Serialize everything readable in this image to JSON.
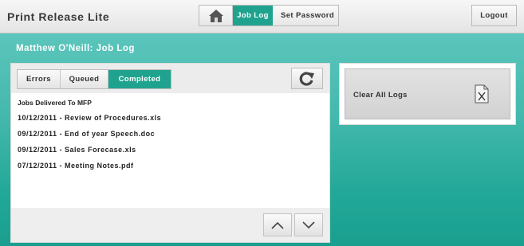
{
  "header": {
    "app_title": "Print Release Lite",
    "nav": {
      "home_icon": "home-icon",
      "job_log_label": "Job Log",
      "set_password_label": "Set Password"
    },
    "logout_label": "Logout"
  },
  "page": {
    "title": "Matthew O'Neill: Job Log"
  },
  "tabs": [
    {
      "label": "Errors",
      "selected": false
    },
    {
      "label": "Queued",
      "selected": false
    },
    {
      "label": "Completed",
      "selected": true
    }
  ],
  "toolbar": {
    "refresh_icon": "refresh-icon"
  },
  "job_list": {
    "heading": "Jobs Delivered To MFP",
    "items": [
      "10/12/2011 - Review of Procedures.xls",
      "09/12/2011 - End of year Speech.doc",
      "09/12/2011 - Sales Forecase.xls",
      "07/12/2011 - Meeting Notes.pdf"
    ]
  },
  "pager": {
    "up_icon": "chevron-up-icon",
    "down_icon": "chevron-down-icon"
  },
  "actions": {
    "clear_all_logs_label": "Clear All Logs",
    "clear_icon": "document-x-icon"
  },
  "colors": {
    "accent": "#20a38e",
    "background_teal": "#3db5a8",
    "header_bg": "#ececec"
  }
}
